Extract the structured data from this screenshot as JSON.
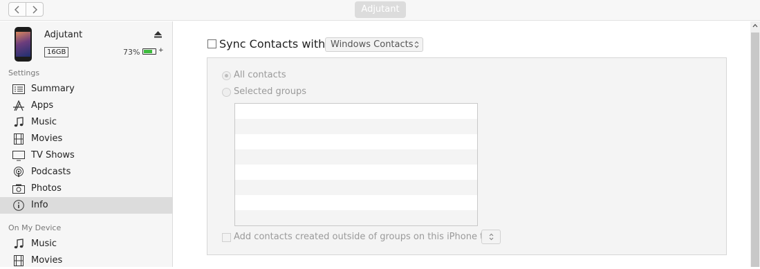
{
  "toolbar": {
    "back_icon": "chevron-left-icon",
    "forward_icon": "chevron-right-icon",
    "device_button": "Adjutant"
  },
  "device": {
    "name": "Adjutant",
    "capacity": "16GB",
    "battery": "73%",
    "battery_level": 0.73
  },
  "sidebar": {
    "settings_header": "Settings",
    "settings_items": [
      {
        "label": "Summary",
        "icon": "summary-icon"
      },
      {
        "label": "Apps",
        "icon": "apps-icon"
      },
      {
        "label": "Music",
        "icon": "music-icon"
      },
      {
        "label": "Movies",
        "icon": "movies-icon"
      },
      {
        "label": "TV Shows",
        "icon": "tv-icon"
      },
      {
        "label": "Podcasts",
        "icon": "podcasts-icon"
      },
      {
        "label": "Photos",
        "icon": "camera-icon"
      },
      {
        "label": "Info",
        "icon": "info-icon",
        "selected": true
      }
    ],
    "on_device_header": "On My Device",
    "on_device_items": [
      {
        "label": "Music",
        "icon": "music-icon"
      },
      {
        "label": "Movies",
        "icon": "movies-icon"
      }
    ]
  },
  "main": {
    "sync_label": "Sync Contacts with",
    "sync_checked": false,
    "sync_source": "Windows Contacts",
    "all_contacts": "All contacts",
    "selected_groups": "Selected groups",
    "add_outside": "Add contacts created outside of groups on this iPhone to:",
    "add_outside_value": ""
  }
}
